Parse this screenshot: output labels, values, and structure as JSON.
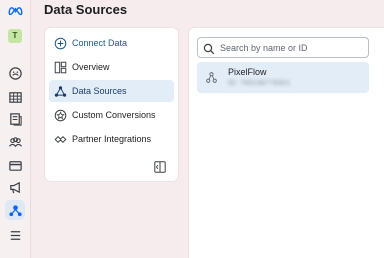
{
  "header": {
    "title": "Data Sources"
  },
  "account": {
    "initial": "T"
  },
  "nav": {
    "connect_label": "Connect Data",
    "items": [
      {
        "label": "Overview",
        "icon": "overview-icon"
      },
      {
        "label": "Data Sources",
        "icon": "data-sources-icon",
        "active": true
      },
      {
        "label": "Custom Conversions",
        "icon": "custom-conversions-icon"
      },
      {
        "label": "Partner Integrations",
        "icon": "partner-integrations-icon"
      }
    ]
  },
  "search": {
    "placeholder": "Search by name or ID",
    "value": ""
  },
  "sources": [
    {
      "name": "PixelFlow",
      "id": "ID: 795238779301"
    }
  ],
  "colors": {
    "brand": "#0866ff",
    "active_bg": "#e2edf8",
    "page_bg": "#f7eced"
  }
}
